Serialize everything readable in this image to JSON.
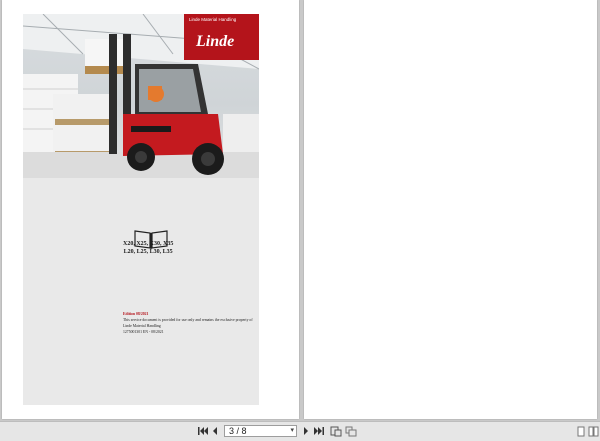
{
  "cover": {
    "brand_tagline": "Linde Material Handling",
    "brand_logo": "Linde",
    "model_line_1": "X20, X25, X30, X35",
    "model_line_2": "L20, L25, L30, L35",
    "edition": "Edition 08/2021",
    "notice_line_1": "This service document is provided for use only and remains the exclusive property of",
    "notice_line_2": "Linde Material Handling",
    "notice_line_3": "1275001301 EN - 08/2021"
  },
  "toolbar": {
    "current_page": "3",
    "page_display": "3 / 8",
    "icons": [
      "first-page-icon",
      "previous-page-icon",
      "next-page-icon",
      "last-page-icon",
      "rotate-icon",
      "page-thumbnails-icon",
      "single-page-icon",
      "two-page-icon"
    ]
  },
  "colors": {
    "brand_red": "#b4141b",
    "cover_gray": "#e9e9e9",
    "viewer_background": "#c9c9c9"
  }
}
